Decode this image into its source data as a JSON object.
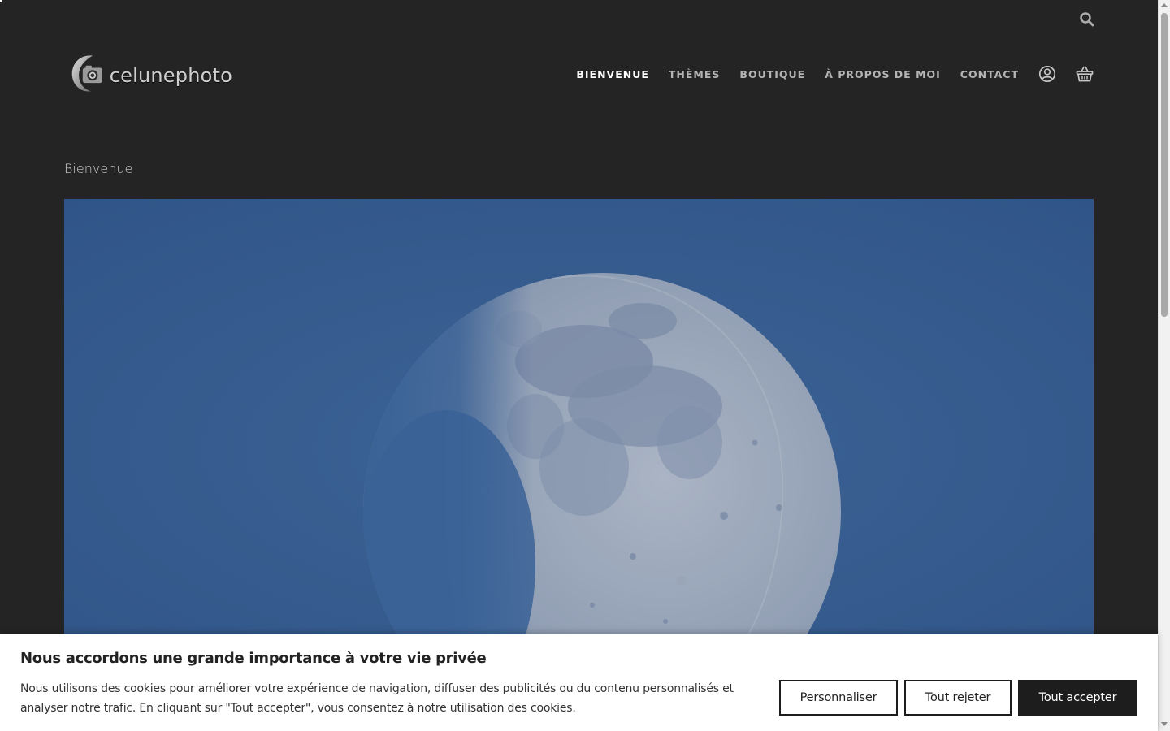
{
  "brand": {
    "name": "celunephoto"
  },
  "nav": {
    "items": [
      {
        "label": "BIENVENUE",
        "active": true
      },
      {
        "label": "THÈMES",
        "active": false
      },
      {
        "label": "BOUTIQUE",
        "active": false
      },
      {
        "label": "À PROPOS DE MOI",
        "active": false
      },
      {
        "label": "CONTACT",
        "active": false
      }
    ],
    "icons": [
      "search-icon",
      "account-icon",
      "basket-icon"
    ]
  },
  "page": {
    "title": "Bienvenue"
  },
  "hero": {
    "subject": "moon-photo"
  },
  "cookie_banner": {
    "title": "Nous accordons une grande importance à votre vie privée",
    "text": "Nous utilisons des cookies pour améliorer votre expérience de navigation, diffuser des publicités ou du contenu personnalisés et analyser notre trafic. En cliquant sur \"Tout accepter\", vous consentez à notre utilisation des cookies.",
    "buttons": {
      "customize": "Personnaliser",
      "reject": "Tout rejeter",
      "accept": "Tout accepter"
    }
  },
  "colors": {
    "background": "#242424",
    "sky": "#355a8c",
    "nav_active": "#ffffff",
    "nav_inactive": "#b4b4b4",
    "accept_button": "#1d1d1d"
  }
}
